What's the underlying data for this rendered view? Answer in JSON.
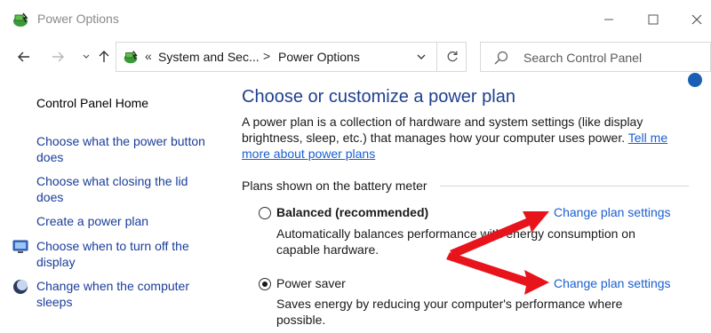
{
  "window": {
    "title": "Power Options",
    "icons": {
      "app": "power-options-icon",
      "minimize": "minimize-icon",
      "maximize": "maximize-icon",
      "close": "close-icon"
    }
  },
  "navigation": {
    "back_icon": "arrow-left-icon",
    "forward_icon": "arrow-right-icon",
    "recent_icon": "chevron-down-icon",
    "up_icon": "arrow-up-icon",
    "address": {
      "overflow": "«",
      "crumbs": [
        "System and Sec...",
        "Power Options"
      ],
      "separator": ">"
    },
    "refresh_icon": "refresh-icon",
    "search": {
      "placeholder": "Search Control Panel",
      "value": ""
    }
  },
  "sidebar": {
    "home": "Control Panel Home",
    "links": [
      {
        "label": "Choose what the power button does"
      },
      {
        "label": "Choose what closing the lid does"
      },
      {
        "label": "Create a power plan"
      },
      {
        "label": "Choose when to turn off the display",
        "icon": "display-icon"
      },
      {
        "label": "Change when the computer sleeps",
        "icon": "moon-icon"
      }
    ]
  },
  "main": {
    "title": "Choose or customize a power plan",
    "intro_text": "A power plan is a collection of hardware and system settings (like display brightness, sleep, etc.) that manages how your computer uses power. ",
    "intro_link": "Tell me more about power plans",
    "group_label": "Plans shown on the battery meter",
    "plans": [
      {
        "name": "Balanced (recommended)",
        "selected": false,
        "description": "Automatically balances performance with energy consumption on capable hardware.",
        "link": "Change plan settings"
      },
      {
        "name": "Power saver",
        "selected": true,
        "description": "Saves energy by reducing your computer's performance where possible.",
        "link": "Change plan settings"
      }
    ]
  },
  "colors": {
    "link": "#1a5fd0",
    "heading": "#1e3f8f",
    "annotation_arrow": "#e8141c"
  }
}
